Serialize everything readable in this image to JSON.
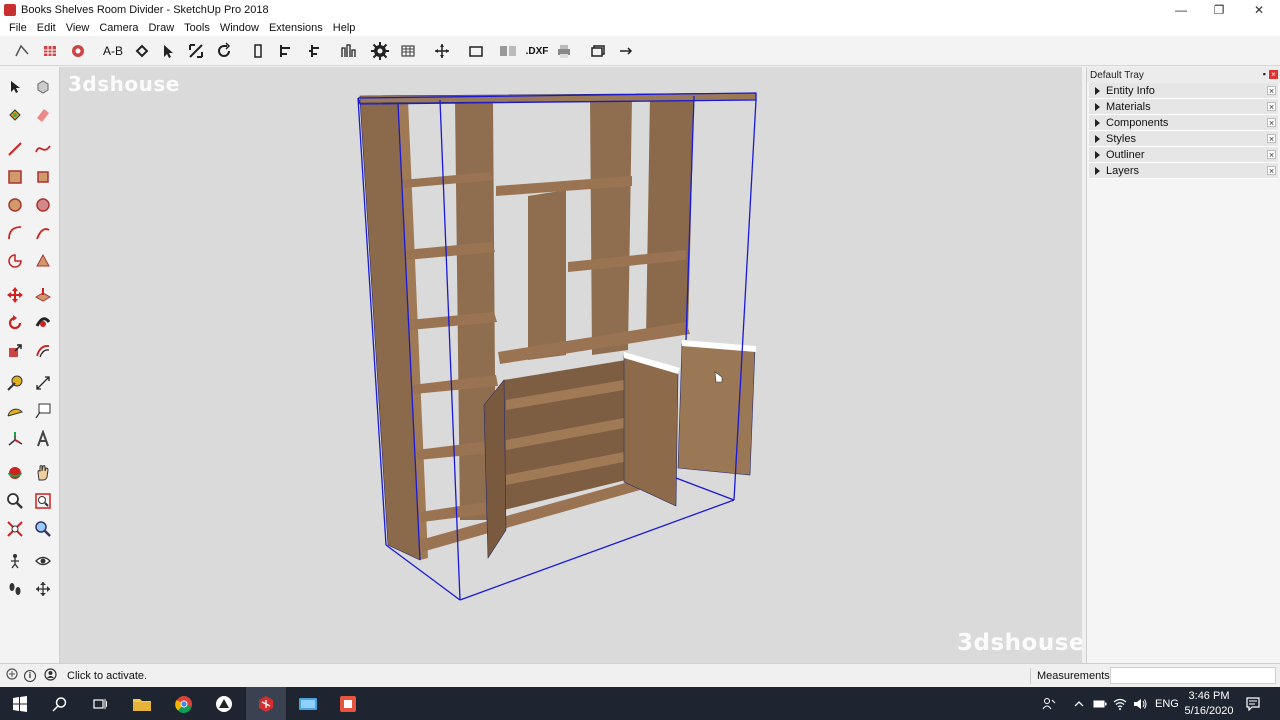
{
  "window": {
    "title": "Books Shelves Room Divider - SketchUp Pro 2018",
    "minimize_glyph": "—",
    "maximize_glyph": "❐",
    "close_glyph": "✕"
  },
  "menu": [
    "File",
    "Edit",
    "View",
    "Camera",
    "Draw",
    "Tools",
    "Window",
    "Extensions",
    "Help"
  ],
  "toolbar": {
    "text_tool_label": "A-B",
    "dxf_label": ".DXF"
  },
  "viewport": {
    "watermark_top": "3dshouse",
    "watermark_bottom": "3dshouse",
    "model_color": "#8a6a4a",
    "selection_color": "#1a1ad6"
  },
  "tray": {
    "title": "Default Tray",
    "pin_glyph": "▪",
    "panels": [
      "Entity Info",
      "Materials",
      "Components",
      "Styles",
      "Outliner",
      "Layers"
    ]
  },
  "status": {
    "message": "Click to activate.",
    "measurements_label": "Measurements",
    "measurements_value": ""
  },
  "taskbar": {
    "language": "ENG",
    "time": "3:46 PM",
    "date": "5/16/2020"
  }
}
